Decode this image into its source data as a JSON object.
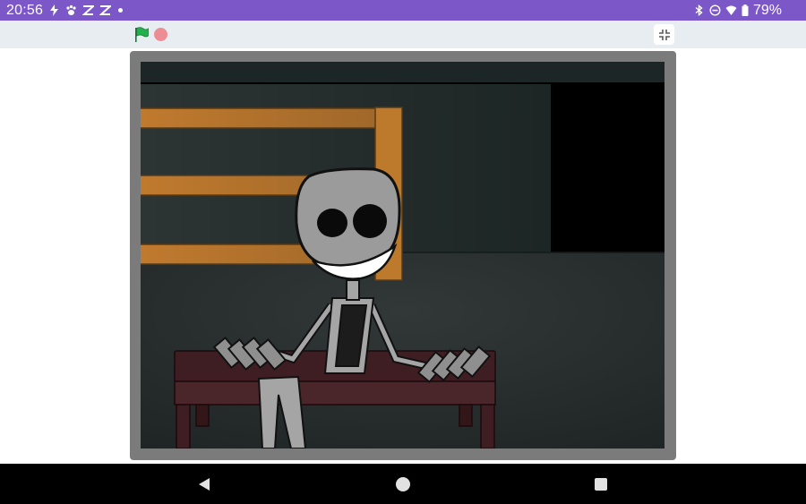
{
  "status_bar": {
    "time": "20:56",
    "battery": "79%",
    "left_icons": [
      "bolt-icon",
      "paw-icon",
      "capcut-icon",
      "capcut-icon",
      "dot-icon"
    ],
    "right_icons": [
      "bluetooth-icon",
      "do-not-disturb-icon",
      "wifi-icon",
      "battery-icon"
    ],
    "bg_color": "#7b57c8"
  },
  "toolbar": {
    "icons": [
      "green-flag-icon",
      "stop-icon",
      "exit-fullscreen-icon"
    ],
    "flag_color": "#22b14c",
    "stop_color": "#ee8c95"
  },
  "stage": {
    "scene_colors": {
      "wall": "#2a3030",
      "doorway": "#000000",
      "wood": "#c07a2e",
      "bench": "#3e1e22",
      "character": "#9b9b9b"
    }
  },
  "nav_bar": {
    "icons": [
      "back-icon",
      "home-icon",
      "recents-icon"
    ]
  }
}
